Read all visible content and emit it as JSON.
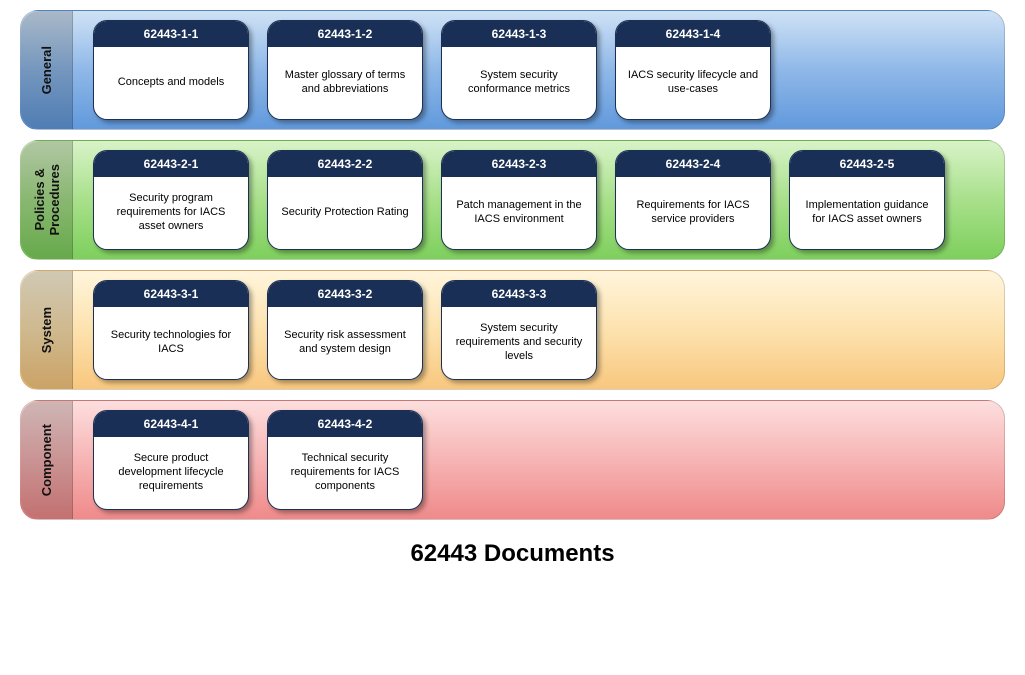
{
  "title": "62443 Documents",
  "rows": [
    {
      "label": "General",
      "theme": "general",
      "cards": [
        {
          "code": "62443-1-1",
          "desc": "Concepts and models"
        },
        {
          "code": "62443-1-2",
          "desc": "Master glossary of terms and abbreviations"
        },
        {
          "code": "62443-1-3",
          "desc": "System security conformance metrics"
        },
        {
          "code": "62443-1-4",
          "desc": "IACS security lifecycle and use-cases"
        }
      ]
    },
    {
      "label": "Policies &\nProcedures",
      "theme": "policies",
      "cards": [
        {
          "code": "62443-2-1",
          "desc": "Security program requirements for IACS asset owners"
        },
        {
          "code": "62443-2-2",
          "desc": "Security Protection Rating"
        },
        {
          "code": "62443-2-3",
          "desc": "Patch management in the IACS environment"
        },
        {
          "code": "62443-2-4",
          "desc": "Requirements for IACS service providers"
        },
        {
          "code": "62443-2-5",
          "desc": "Implementation guidance for IACS asset owners"
        }
      ]
    },
    {
      "label": "System",
      "theme": "system",
      "cards": [
        {
          "code": "62443-3-1",
          "desc": "Security technologies for IACS"
        },
        {
          "code": "62443-3-2",
          "desc": "Security risk assessment and system design"
        },
        {
          "code": "62443-3-3",
          "desc": "System security requirements and security levels"
        }
      ]
    },
    {
      "label": "Component",
      "theme": "component",
      "cards": [
        {
          "code": "62443-4-1",
          "desc": "Secure product development lifecycle requirements"
        },
        {
          "code": "62443-4-2",
          "desc": "Technical security requirements for IACS components"
        }
      ]
    }
  ]
}
